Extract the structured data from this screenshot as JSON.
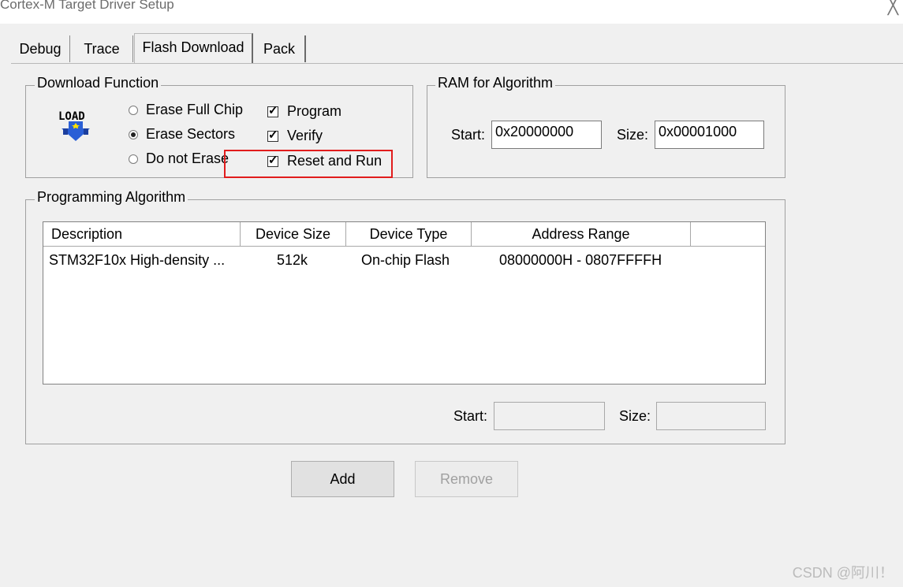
{
  "window": {
    "title": "Cortex-M Target Driver Setup",
    "close_glyph": "╳"
  },
  "tabs": [
    {
      "label": "Debug"
    },
    {
      "label": "Trace"
    },
    {
      "label": "Flash Download"
    },
    {
      "label": "Pack"
    }
  ],
  "download_function": {
    "legend": "Download Function",
    "icon_label": "LOAD",
    "radios": [
      {
        "label": "Erase Full Chip",
        "checked": false
      },
      {
        "label": "Erase Sectors",
        "checked": true
      },
      {
        "label": "Do not Erase",
        "checked": false
      }
    ],
    "checks": [
      {
        "label": "Program",
        "checked": true
      },
      {
        "label": "Verify",
        "checked": true
      },
      {
        "label": "Reset and Run",
        "checked": true
      }
    ]
  },
  "ram": {
    "legend": "RAM for Algorithm",
    "start_label": "Start:",
    "start_value": "0x20000000",
    "size_label": "Size:",
    "size_value": "0x00001000"
  },
  "algorithm": {
    "legend": "Programming Algorithm",
    "columns": [
      "Description",
      "Device Size",
      "Device Type",
      "Address Range"
    ],
    "rows": [
      {
        "description": "STM32F10x High-density ...",
        "size": "512k",
        "type": "On-chip Flash",
        "range": "08000000H - 0807FFFFH"
      }
    ],
    "start_label": "Start:",
    "start_value": "",
    "size_label": "Size:",
    "size_value": ""
  },
  "buttons": {
    "add": "Add",
    "remove": "Remove"
  },
  "watermark": "CSDN @阿川！",
  "colors": {
    "highlight": "#e11c1c"
  }
}
